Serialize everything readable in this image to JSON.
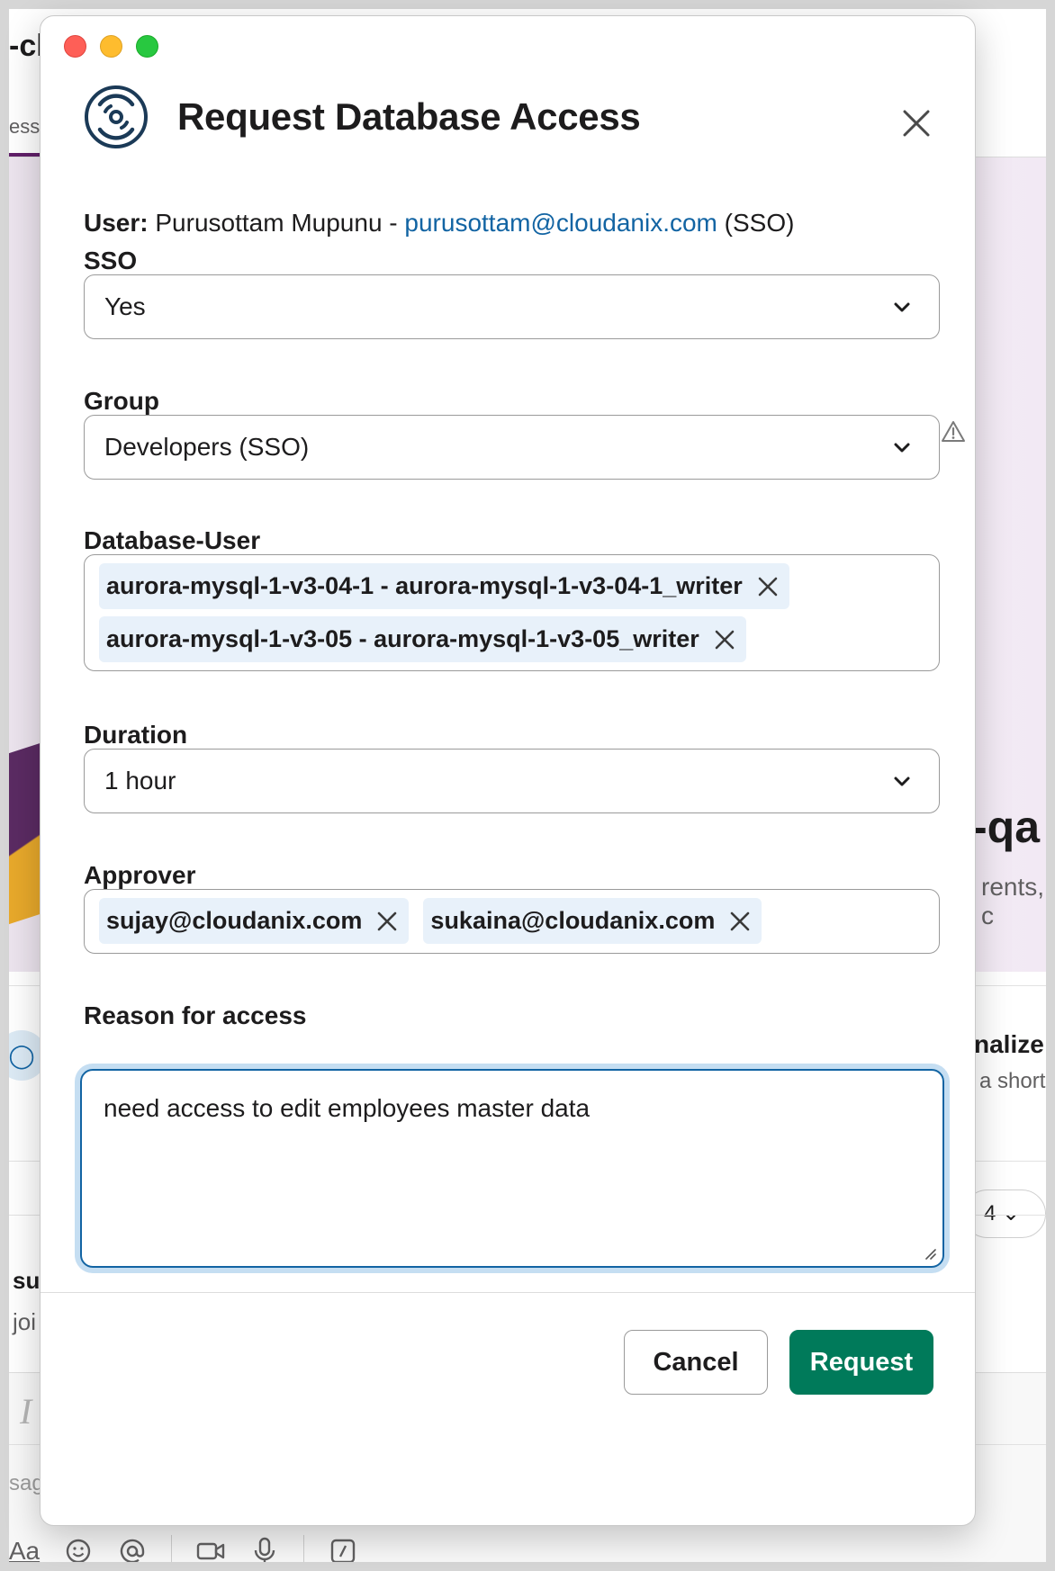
{
  "background": {
    "workspace_title": "-cl",
    "tab_label": "essa",
    "heading_fragment": "-qa",
    "sub_fragment": "rents, c",
    "personalize_fragment": "nalize",
    "short_fragment": "a short",
    "pill_value": "4",
    "sender_fragment": "su",
    "message_fragment": "joi",
    "composer_format_glyph": "I",
    "composer_placeholder": "sag",
    "format_button_label": "Aa"
  },
  "modal": {
    "title": "Request Database Access",
    "user": {
      "label": "User:",
      "name": "Purusottam Mupunu -",
      "email": "purusottam@cloudanix.com",
      "suffix": "(SSO)"
    },
    "fields": {
      "sso": {
        "label": "SSO",
        "value": "Yes"
      },
      "group": {
        "label": "Group",
        "value": "Developers (SSO)",
        "status_icon": "warning-icon"
      },
      "database_user": {
        "label": "Database-User",
        "selected": [
          "aurora-mysql-1-v3-04-1 - aurora-mysql-1-v3-04-1_writer",
          "aurora-mysql-1-v3-05 - aurora-mysql-1-v3-05_writer"
        ]
      },
      "duration": {
        "label": "Duration",
        "value": "1 hour"
      },
      "approver": {
        "label": "Approver",
        "selected": [
          "sujay@cloudanix.com",
          "sukaina@cloudanix.com"
        ]
      },
      "reason": {
        "label": "Reason for access",
        "value": "need access to edit employees master data"
      }
    },
    "buttons": {
      "cancel": "Cancel",
      "submit": "Request"
    }
  },
  "colors": {
    "accent_link": "#1264a3",
    "primary_button": "#007a5a",
    "chip_background": "#e8f1fa",
    "focus_ring": "#c5def2"
  }
}
